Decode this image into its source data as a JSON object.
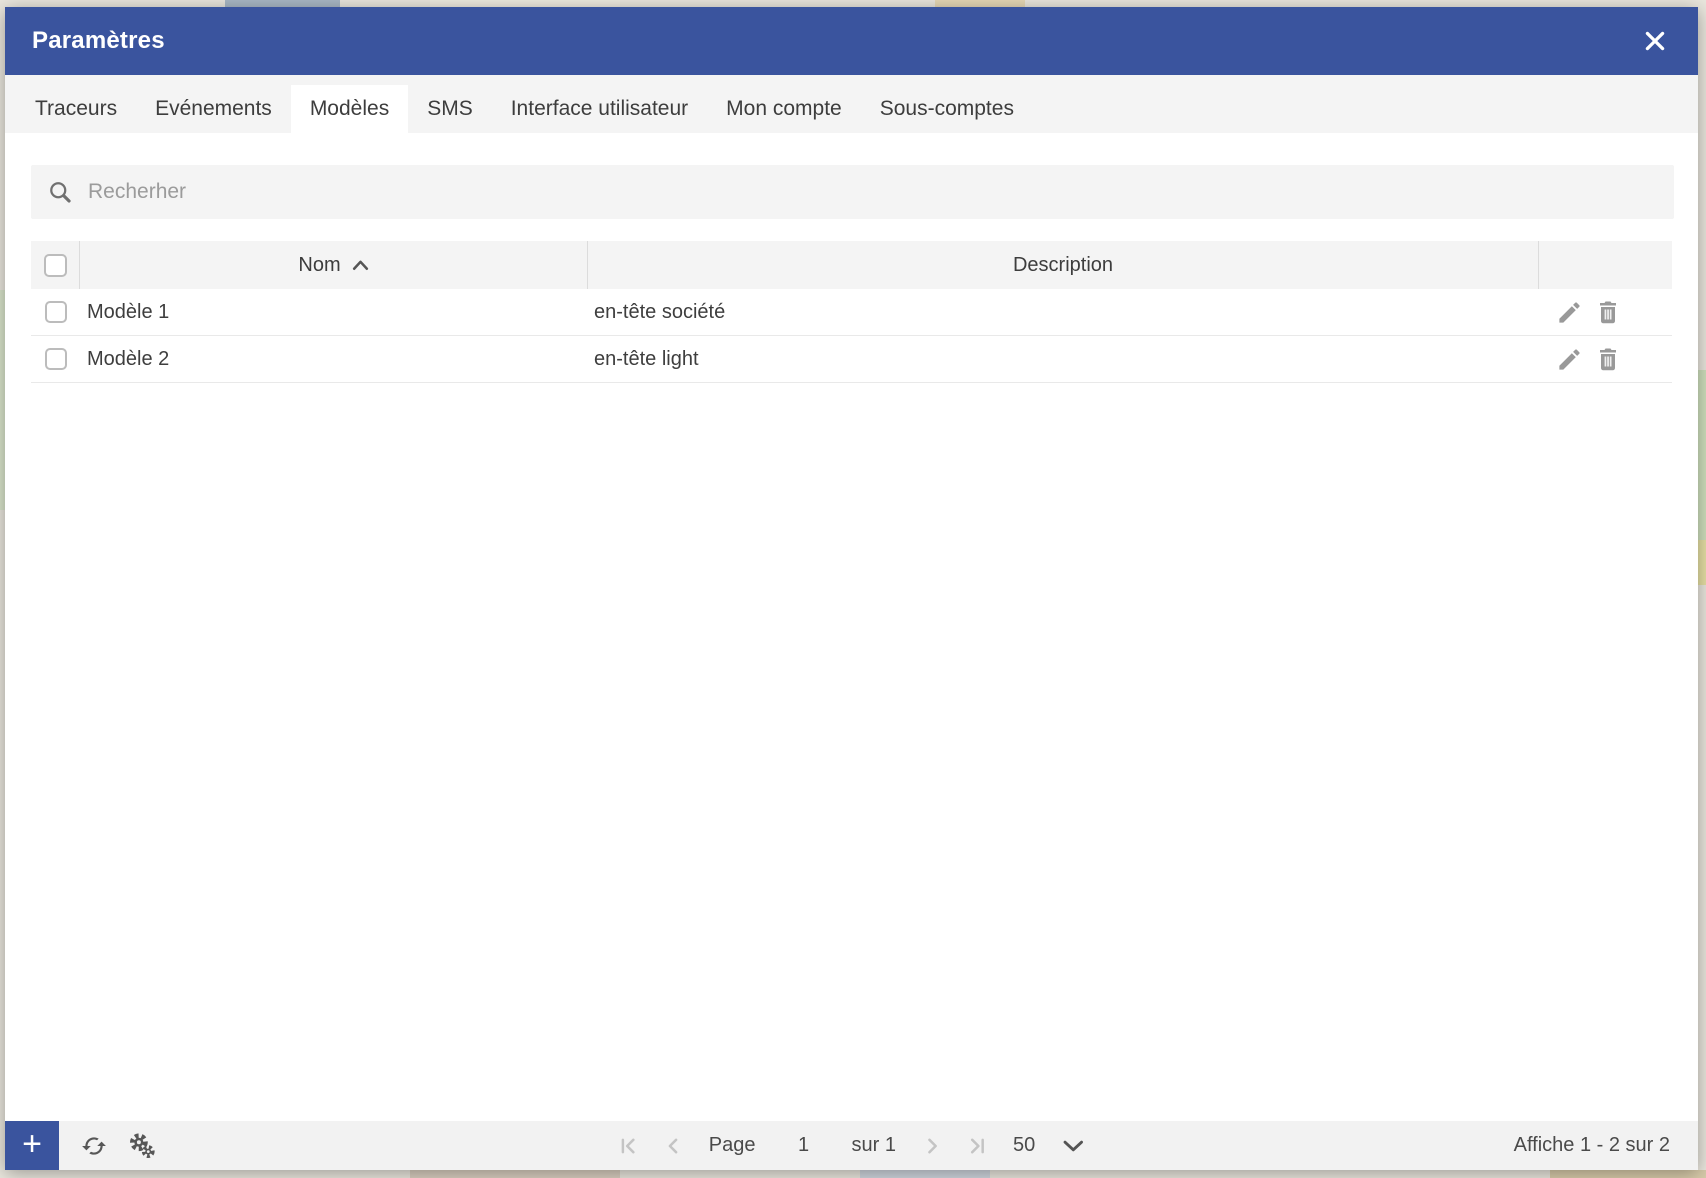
{
  "window": {
    "title": "Paramètres",
    "close_label": "✕"
  },
  "tabs": [
    {
      "label": "Traceurs",
      "active": false
    },
    {
      "label": "Evénements",
      "active": false
    },
    {
      "label": "Modèles",
      "active": true
    },
    {
      "label": "SMS",
      "active": false
    },
    {
      "label": "Interface utilisateur",
      "active": false
    },
    {
      "label": "Mon compte",
      "active": false
    },
    {
      "label": "Sous-comptes",
      "active": false
    }
  ],
  "search": {
    "placeholder": "Recherher"
  },
  "table": {
    "columns": {
      "name": "Nom",
      "description": "Description"
    },
    "sort": {
      "column": "Nom",
      "direction": "asc"
    },
    "rows": [
      {
        "name": "Modèle 1",
        "description": "en-tête société",
        "checked": false
      },
      {
        "name": "Modèle 2",
        "description": "en-tête light",
        "checked": false
      }
    ]
  },
  "toolbar": {
    "add_label": "+",
    "pagination": {
      "page_label": "Page",
      "current_page": "1",
      "total_label": "sur 1",
      "page_size": "50"
    },
    "status": "Affiche 1 - 2 sur 2"
  },
  "colors": {
    "accent_blue": "#3a549e",
    "panel_gray": "#f4f4f4",
    "text_dark": "#3e3e3e",
    "icon_gray": "#999999",
    "disabled_gray": "#c4c4c4"
  }
}
